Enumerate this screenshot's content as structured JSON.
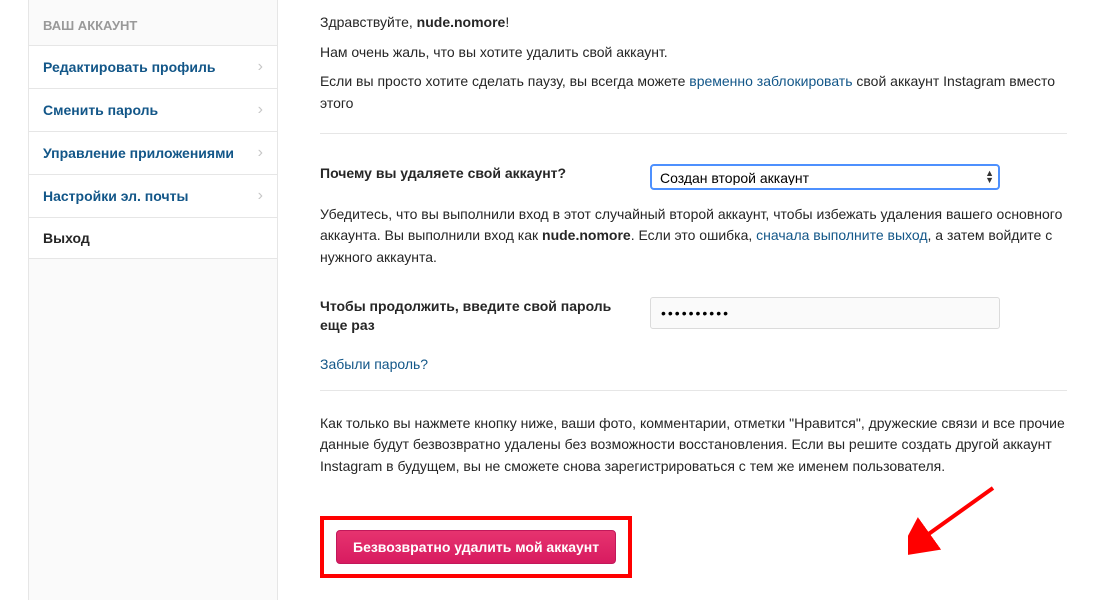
{
  "sidebar": {
    "header": "ВАШ АККАУНТ",
    "items": [
      {
        "label": "Редактировать профиль",
        "link": true,
        "chev": true
      },
      {
        "label": "Сменить пароль",
        "link": true,
        "chev": true
      },
      {
        "label": "Управление приложениями",
        "link": true,
        "chev": true
      },
      {
        "label": "Настройки эл. почты",
        "link": true,
        "chev": true
      },
      {
        "label": "Выход",
        "link": false,
        "chev": false
      }
    ]
  },
  "main": {
    "greeting_prefix": "Здравствуйте, ",
    "username": "nude.nomore",
    "greeting_suffix": "!",
    "sorry_text": "Нам очень жаль, что вы хотите удалить свой аккаунт.",
    "pause_prefix": "Если вы просто хотите сделать паузу, вы всегда можете ",
    "pause_link": "временно заблокировать",
    "pause_suffix": " свой аккаунт Instagram вместо этого",
    "reason_label": "Почему вы удаляете свой аккаунт?",
    "reason_value": "Создан второй аккаунт",
    "confirm_prefix": "Убедитесь, что вы выполнили вход в этот случайный второй аккаунт, чтобы избежать удаления вашего основного аккаунта. Вы выполнили вход как ",
    "confirm_user": "nude.nomore",
    "confirm_mid": ". Если это ошибка, ",
    "confirm_link": "сначала выполните выход",
    "confirm_suffix": ", а затем войдите с нужного аккаунта.",
    "password_label": "Чтобы продолжить, введите свой пароль еще раз",
    "password_value": "••••••••••",
    "forgot_link": "Забыли пароль?",
    "warning_text": "Как только вы нажмете кнопку ниже, ваши фото, комментарии, отметки \"Нравится\", дружеские связи и все прочие данные будут безвозвратно удалены без возможности восстановления. Если вы решите создать другой аккаунт Instagram в будущем, вы не сможете снова зарегистрироваться с тем же именем пользователя.",
    "delete_button": "Безвозвратно удалить мой аккаунт"
  }
}
